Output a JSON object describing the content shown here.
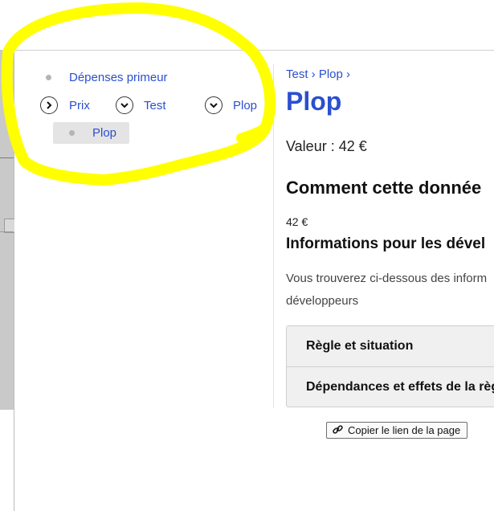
{
  "nav": {
    "item_depenses": "Dépenses primeur",
    "item_prix": "Prix",
    "item_test": "Test",
    "item_plop": "Plop",
    "item_plop_selected": "Plop"
  },
  "breadcrumb": "Test › Plop ›",
  "page": {
    "title": "Plop",
    "value_line": "Valeur : 42 €",
    "section_heading": "Comment cette donnée",
    "amount": "42 €",
    "dev_heading": "Informations pour les dével",
    "dev_paragraph": "Vous trouverez ci-dessous des inform développeurs"
  },
  "accordion": {
    "rule_label": "Règle et situation",
    "deps_label": "Dépendances et effets de la règ"
  },
  "copy_button_label": "Copier le lien de la page",
  "colors": {
    "link": "#2b4fcf",
    "highlight": "#ffff00"
  }
}
